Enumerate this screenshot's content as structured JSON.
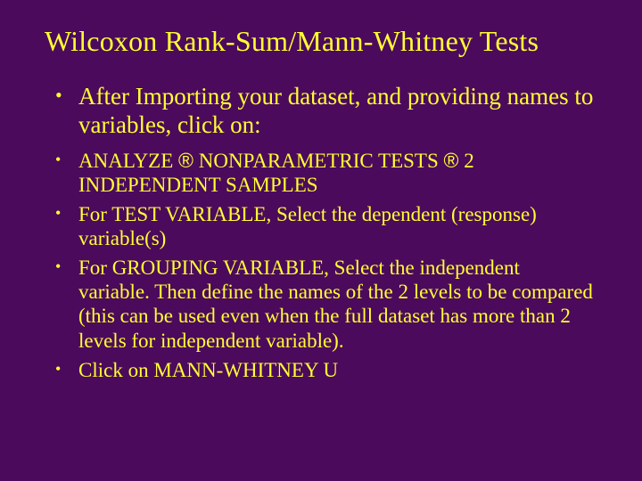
{
  "title": "Wilcoxon Rank-Sum/Mann-Whitney Tests",
  "body": {
    "intro": "After Importing your dataset, and providing names to variables, click on:"
  },
  "steps": {
    "s1_a": "ANALYZE ",
    "s1_b": " NONPARAMETRIC TESTS ",
    "s1_c": " 2 INDEPENDENT SAMPLES",
    "s2": "For TEST VARIABLE, Select the dependent (response) variable(s)",
    "s3": "For GROUPING VARIABLE, Select the independent variable. Then define the names of the 2 levels to be compared (this can be used even when the full dataset has more than 2 levels for independent variable).",
    "s4": "Click on MANN-WHITNEY U"
  },
  "glyphs": {
    "arrow": "®"
  }
}
